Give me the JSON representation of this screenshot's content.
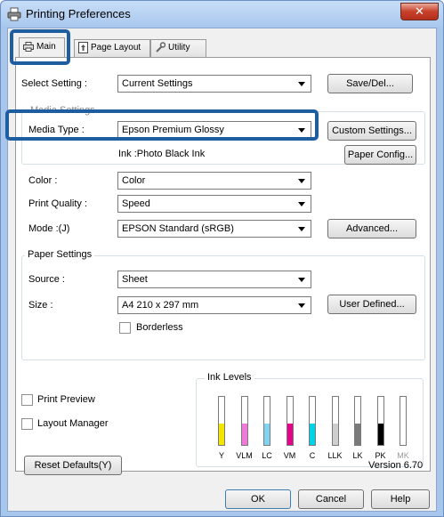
{
  "window": {
    "title": "Printing Preferences",
    "close_label": "✕"
  },
  "tabs": [
    {
      "label": "Main",
      "icon": "printer-icon"
    },
    {
      "label": "Page Layout",
      "icon": "page-icon"
    },
    {
      "label": "Utility",
      "icon": "wrench-icon"
    }
  ],
  "select_setting": {
    "label": "Select Setting :",
    "value": "Current Settings",
    "button": "Save/Del..."
  },
  "media_settings": {
    "group_title": "Media Settings",
    "media_type_label": "Media Type :",
    "media_type_value": "Epson Premium Glossy",
    "custom_settings": "Custom Settings...",
    "ink_text": "Ink :Photo Black Ink",
    "paper_config": "Paper Config..."
  },
  "color": {
    "label": "Color :",
    "value": "Color"
  },
  "print_quality": {
    "label": "Print Quality :",
    "value": "Speed"
  },
  "mode": {
    "label": "Mode :(J)",
    "value": "EPSON Standard (sRGB)",
    "button": "Advanced..."
  },
  "paper_settings": {
    "group_title": "Paper Settings",
    "source_label": "Source :",
    "source_value": "Sheet",
    "size_label": "Size :",
    "size_value": "A4 210 x 297 mm",
    "user_defined": "User Defined...",
    "borderless": "Borderless"
  },
  "print_preview": "Print Preview",
  "layout_manager": "Layout Manager",
  "ink_levels": {
    "title": "Ink Levels",
    "inks": [
      {
        "name": "Y",
        "color": "#f2e600",
        "level": 0.45
      },
      {
        "name": "VLM",
        "color": "#f07ad8",
        "level": 0.45
      },
      {
        "name": "LC",
        "color": "#7fd4f2",
        "level": 0.45
      },
      {
        "name": "VM",
        "color": "#e6008a",
        "level": 0.45
      },
      {
        "name": "C",
        "color": "#00d2e6",
        "level": 0.45
      },
      {
        "name": "LLK",
        "color": "#cfcfcf",
        "level": 0.45
      },
      {
        "name": "LK",
        "color": "#7a7a7a",
        "level": 0.45
      },
      {
        "name": "PK",
        "color": "#000000",
        "level": 0.45
      },
      {
        "name": "MK",
        "color": "#ffffff",
        "level": 0.0
      }
    ]
  },
  "reset_defaults": "Reset Defaults(Y)",
  "version": "Version 6.70",
  "footer": {
    "ok": "OK",
    "cancel": "Cancel",
    "help": "Help"
  },
  "colors": {
    "highlight": "#1e5ea0",
    "titlebar": "#a9c7ee",
    "close": "#c7402a"
  }
}
